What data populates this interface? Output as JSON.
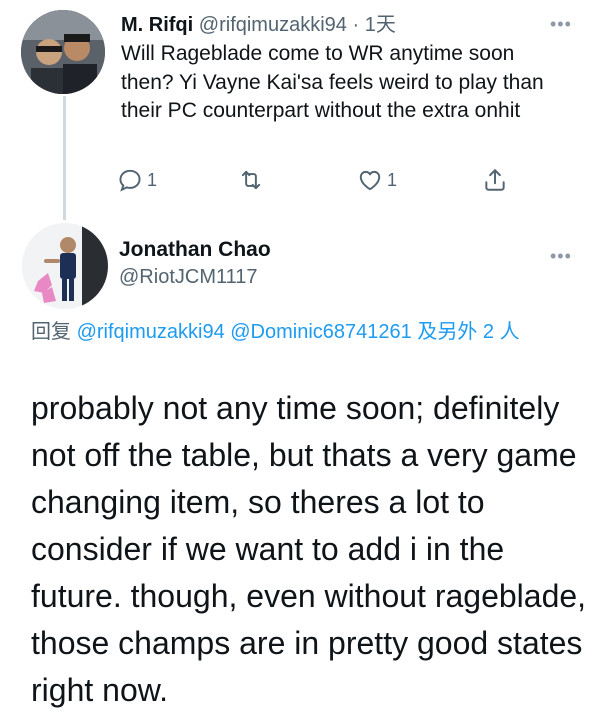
{
  "tweet1": {
    "name": "M. Rifqi",
    "handle": "@rifqimuzakki94",
    "separator": "·",
    "time": "1天",
    "more": "•••",
    "text": "Will Rageblade come to WR anytime soon then? Yi Vayne Kai'sa feels weird to play than their PC counterpart without the extra onhit",
    "actions": {
      "reply_count": "1",
      "retweet_count": "",
      "like_count": "1"
    }
  },
  "tweet2": {
    "name": "Jonathan Chao",
    "handle": "@RiotJCM1117",
    "more": "•••",
    "reply_prefix": "回复",
    "reply_mention1": "@rifqimuzakki94",
    "reply_mention2": "@Dominic68741261",
    "reply_suffix": "及另外 2 人",
    "text": "probably not any time soon; definitely not off the table, but thats a very game changing item, so theres a lot to consider if we want to add i in the future. though, even without rageblade, those champs are in pretty good states right now."
  },
  "colors": {
    "link": "#1d9bf0",
    "muted": "#536471",
    "text": "#0f1419",
    "thread_line": "#cfd9de"
  },
  "icons": [
    "reply-icon",
    "retweet-icon",
    "like-icon",
    "share-icon",
    "more-icon"
  ]
}
